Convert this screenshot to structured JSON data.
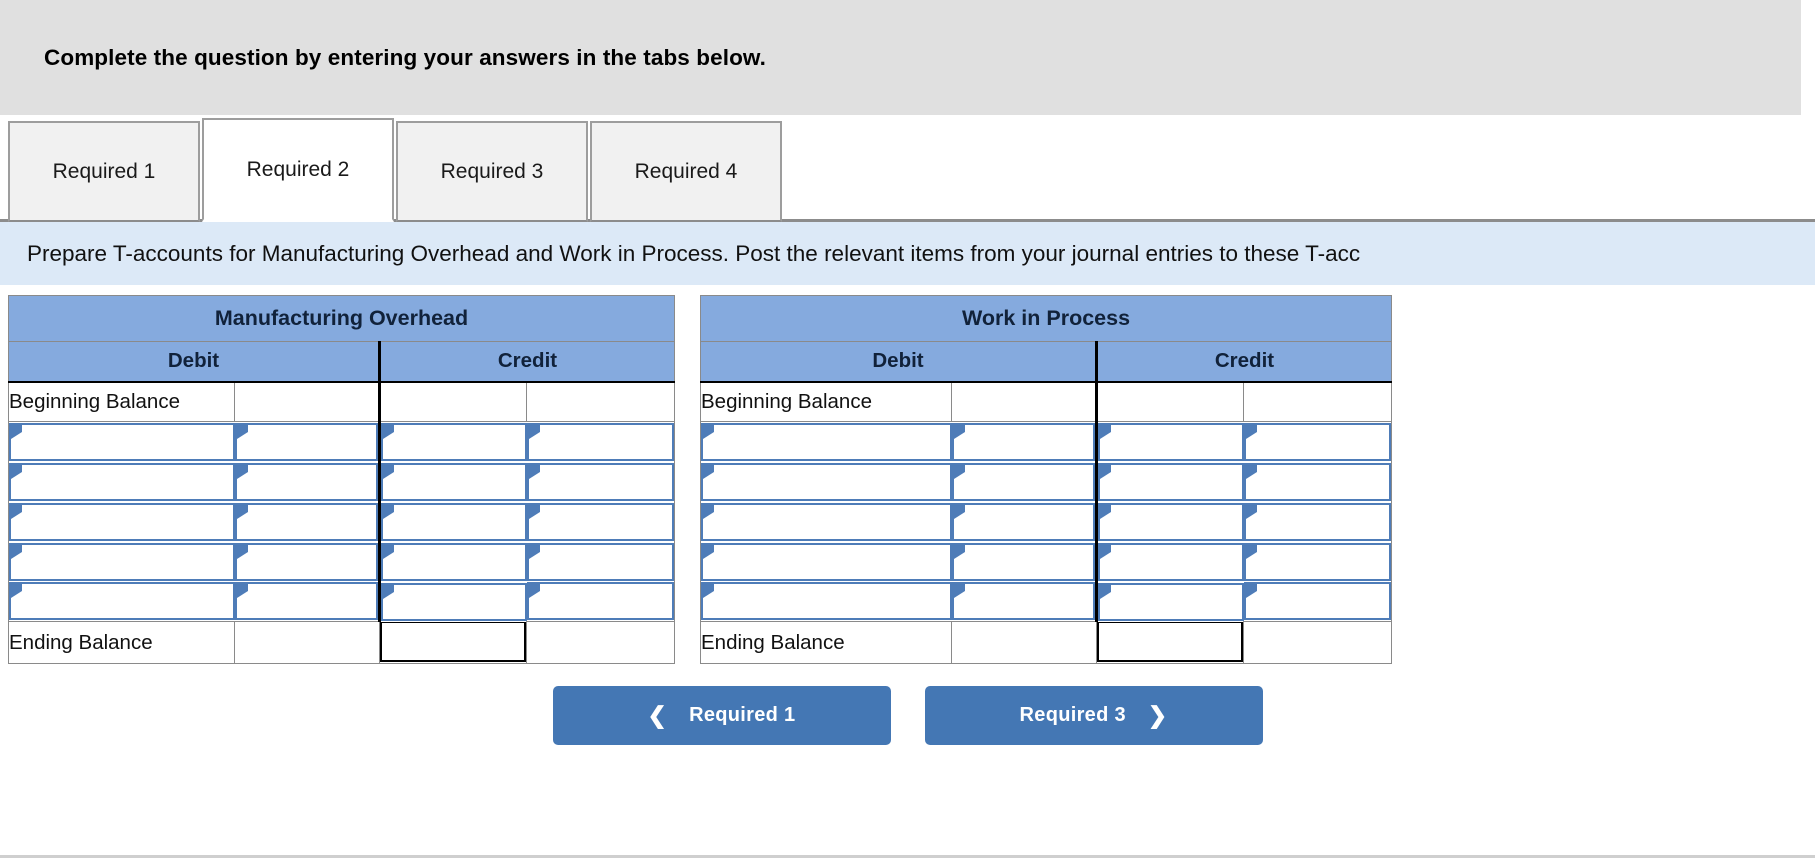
{
  "banner": {
    "text": "Complete the question by entering your answers in the tabs below."
  },
  "tabs": [
    {
      "label": "Required 1",
      "active": false
    },
    {
      "label": "Required 2",
      "active": true
    },
    {
      "label": "Required 3",
      "active": false
    },
    {
      "label": "Required 4",
      "active": false
    }
  ],
  "prompt": {
    "text": "Prepare T-accounts for Manufacturing Overhead and Work in Process. Post the relevant items from your journal entries to these T-acc"
  },
  "accounts": [
    {
      "title": "Manufacturing Overhead",
      "debit_header": "Debit",
      "credit_header": "Credit",
      "beginning_label": "Beginning Balance",
      "ending_label": "Ending Balance",
      "beginning_debit_amount": "",
      "beginning_credit_label": "",
      "beginning_credit_amount": "",
      "ending_debit_amount": "",
      "ending_credit_amount": "",
      "entry_row_count": 5,
      "entries": [
        {
          "debit_label": "",
          "debit_amount": "",
          "credit_label": "",
          "credit_amount": ""
        },
        {
          "debit_label": "",
          "debit_amount": "",
          "credit_label": "",
          "credit_amount": ""
        },
        {
          "debit_label": "",
          "debit_amount": "",
          "credit_label": "",
          "credit_amount": ""
        },
        {
          "debit_label": "",
          "debit_amount": "",
          "credit_label": "",
          "credit_amount": ""
        },
        {
          "debit_label": "",
          "debit_amount": "",
          "credit_label": "",
          "credit_amount": ""
        }
      ]
    },
    {
      "title": "Work in Process",
      "debit_header": "Debit",
      "credit_header": "Credit",
      "beginning_label": "Beginning Balance",
      "ending_label": "Ending Balance",
      "beginning_debit_amount": "",
      "beginning_credit_label": "",
      "beginning_credit_amount": "",
      "ending_debit_amount": "",
      "ending_credit_amount": "",
      "entry_row_count": 5,
      "entries": [
        {
          "debit_label": "",
          "debit_amount": "",
          "credit_label": "",
          "credit_amount": ""
        },
        {
          "debit_label": "",
          "debit_amount": "",
          "credit_label": "",
          "credit_amount": ""
        },
        {
          "debit_label": "",
          "debit_amount": "",
          "credit_label": "",
          "credit_amount": ""
        },
        {
          "debit_label": "",
          "debit_amount": "",
          "credit_label": "",
          "credit_amount": ""
        },
        {
          "debit_label": "",
          "debit_amount": "",
          "credit_label": "",
          "credit_amount": ""
        }
      ]
    }
  ],
  "navigation": {
    "prev_label": "Required 1",
    "next_label": "Required 3",
    "prev_icon": "chevron-left-icon",
    "next_icon": "chevron-right-icon"
  },
  "colors": {
    "banner_bg": "#e0e0e0",
    "prompt_bg": "#dce9f7",
    "header_blue": "#85aade",
    "input_border_blue": "#4e7cb8",
    "button_blue": "#4477b4",
    "tab_inactive_bg": "#f1f1f1",
    "tab_active_bg": "#ffffff"
  }
}
